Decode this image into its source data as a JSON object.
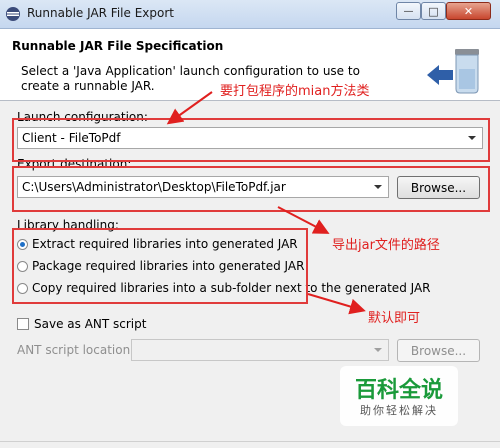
{
  "window": {
    "title": "Runnable JAR File Export",
    "min_glyph": "—",
    "max_glyph": "□",
    "close_glyph": "✕"
  },
  "header": {
    "title": "Runnable JAR File Specification",
    "description": "Select a 'Java Application' launch configuration to use to create a runnable JAR."
  },
  "launch": {
    "label": "Launch configuration:",
    "value": "Client - FileToPdf"
  },
  "export": {
    "label": "Export destination:",
    "value": "C:\\Users\\Administrator\\Desktop\\FileToPdf.jar",
    "browse_label": "Browse..."
  },
  "library": {
    "label": "Library handling:",
    "options": [
      {
        "label": "Extract required libraries into generated JAR",
        "selected": true
      },
      {
        "label": "Package required libraries into generated JAR",
        "selected": false
      },
      {
        "label": "Copy required libraries into a sub-folder next to the generated JAR",
        "selected": false
      }
    ]
  },
  "ant": {
    "checkbox_label": "Save as ANT script",
    "checked": false,
    "location_label": "ANT script location:",
    "location_value": "",
    "browse_label": "Browse..."
  },
  "annotations": {
    "main_class": "要打包程序的mian方法类",
    "export_path": "导出jar文件的路径",
    "default_ok": "默认即可"
  },
  "watermark": {
    "title": "百科全说",
    "subtitle": "助你轻松解决"
  },
  "colors": {
    "annotation": "#e0201f",
    "radio_dot": "#1e6fc7",
    "watermark_green": "#1a9a3a"
  }
}
